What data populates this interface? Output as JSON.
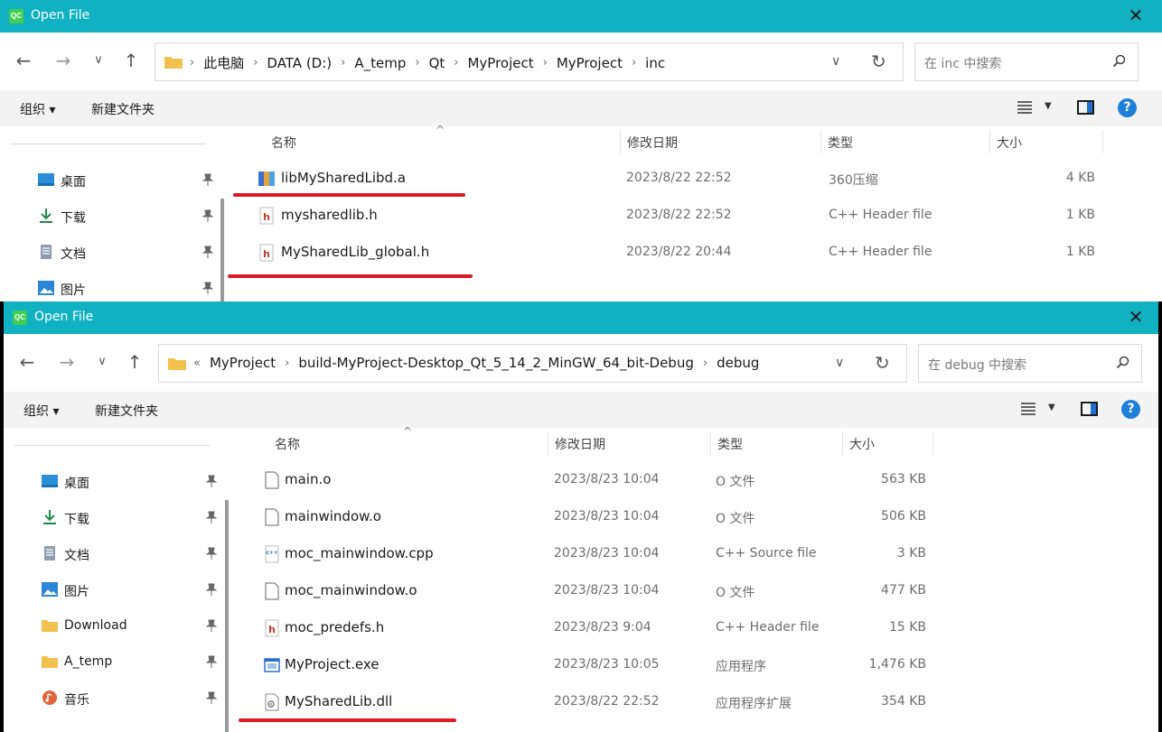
{
  "top_dialog": {
    "title": "Open File",
    "app_icon": "QC",
    "close": "✕",
    "breadcrumb": [
      "此电脑",
      "DATA (D:)",
      "A_temp",
      "Qt",
      "MyProject",
      "MyProject",
      "inc"
    ],
    "search_placeholder": "在 inc 中搜索",
    "organize": "组织 ▾",
    "new_folder": "新建文件夹",
    "help": "?",
    "columns": {
      "name": "名称",
      "date": "修改日期",
      "type": "类型",
      "size": "大小"
    },
    "sidebar": [
      {
        "label": "桌面",
        "icon": "desktop-icon"
      },
      {
        "label": "下载",
        "icon": "download-icon"
      },
      {
        "label": "文档",
        "icon": "document-icon"
      },
      {
        "label": "图片",
        "icon": "pictures-icon"
      }
    ],
    "files": [
      {
        "name": "libMySharedLibd.a",
        "date": "2023/8/22 22:52",
        "type": "360压缩",
        "size": "4 KB",
        "icon": "archive-icon"
      },
      {
        "name": "mysharedlib.h",
        "date": "2023/8/22 22:52",
        "type": "C++ Header file",
        "size": "1 KB",
        "icon": "header-file-icon"
      },
      {
        "name": "MySharedLib_global.h",
        "date": "2023/8/22 20:44",
        "type": "C++ Header file",
        "size": "1 KB",
        "icon": "header-file-icon"
      }
    ]
  },
  "bottom_dialog": {
    "title": "Open File",
    "app_icon": "QC",
    "close": "✕",
    "breadcrumb_overflow": "«",
    "breadcrumb": [
      "MyProject",
      "build-MyProject-Desktop_Qt_5_14_2_MinGW_64_bit-Debug",
      "debug"
    ],
    "search_placeholder": "在 debug 中搜索",
    "organize": "组织 ▾",
    "new_folder": "新建文件夹",
    "help": "?",
    "columns": {
      "name": "名称",
      "date": "修改日期",
      "type": "类型",
      "size": "大小"
    },
    "sidebar": [
      {
        "label": "桌面",
        "icon": "desktop-icon"
      },
      {
        "label": "下载",
        "icon": "download-icon"
      },
      {
        "label": "文档",
        "icon": "document-icon"
      },
      {
        "label": "图片",
        "icon": "pictures-icon"
      },
      {
        "label": "Download",
        "icon": "folder-icon"
      },
      {
        "label": "A_temp",
        "icon": "folder-icon"
      },
      {
        "label": "音乐",
        "icon": "music-icon"
      }
    ],
    "files": [
      {
        "name": "main.o",
        "date": "2023/8/23 10:04",
        "type": "O 文件",
        "size": "563 KB",
        "icon": "blank-file-icon"
      },
      {
        "name": "mainwindow.o",
        "date": "2023/8/23 10:04",
        "type": "O 文件",
        "size": "506 KB",
        "icon": "blank-file-icon"
      },
      {
        "name": "moc_mainwindow.cpp",
        "date": "2023/8/23 10:04",
        "type": "C++ Source file",
        "size": "3 KB",
        "icon": "cpp-source-icon"
      },
      {
        "name": "moc_mainwindow.o",
        "date": "2023/8/23 10:04",
        "type": "O 文件",
        "size": "477 KB",
        "icon": "blank-file-icon"
      },
      {
        "name": "moc_predefs.h",
        "date": "2023/8/23 9:04",
        "type": "C++ Header file",
        "size": "15 KB",
        "icon": "header-file-icon"
      },
      {
        "name": "MyProject.exe",
        "date": "2023/8/23 10:05",
        "type": "应用程序",
        "size": "1,476 KB",
        "icon": "exe-icon"
      },
      {
        "name": "MySharedLib.dll",
        "date": "2023/8/22 22:52",
        "type": "应用程序扩展",
        "size": "354 KB",
        "icon": "dll-icon"
      }
    ]
  },
  "accent_colors": {
    "titlebar": "#10b1c1",
    "highlight": "#d81b22",
    "folder": "#f2c14e"
  }
}
